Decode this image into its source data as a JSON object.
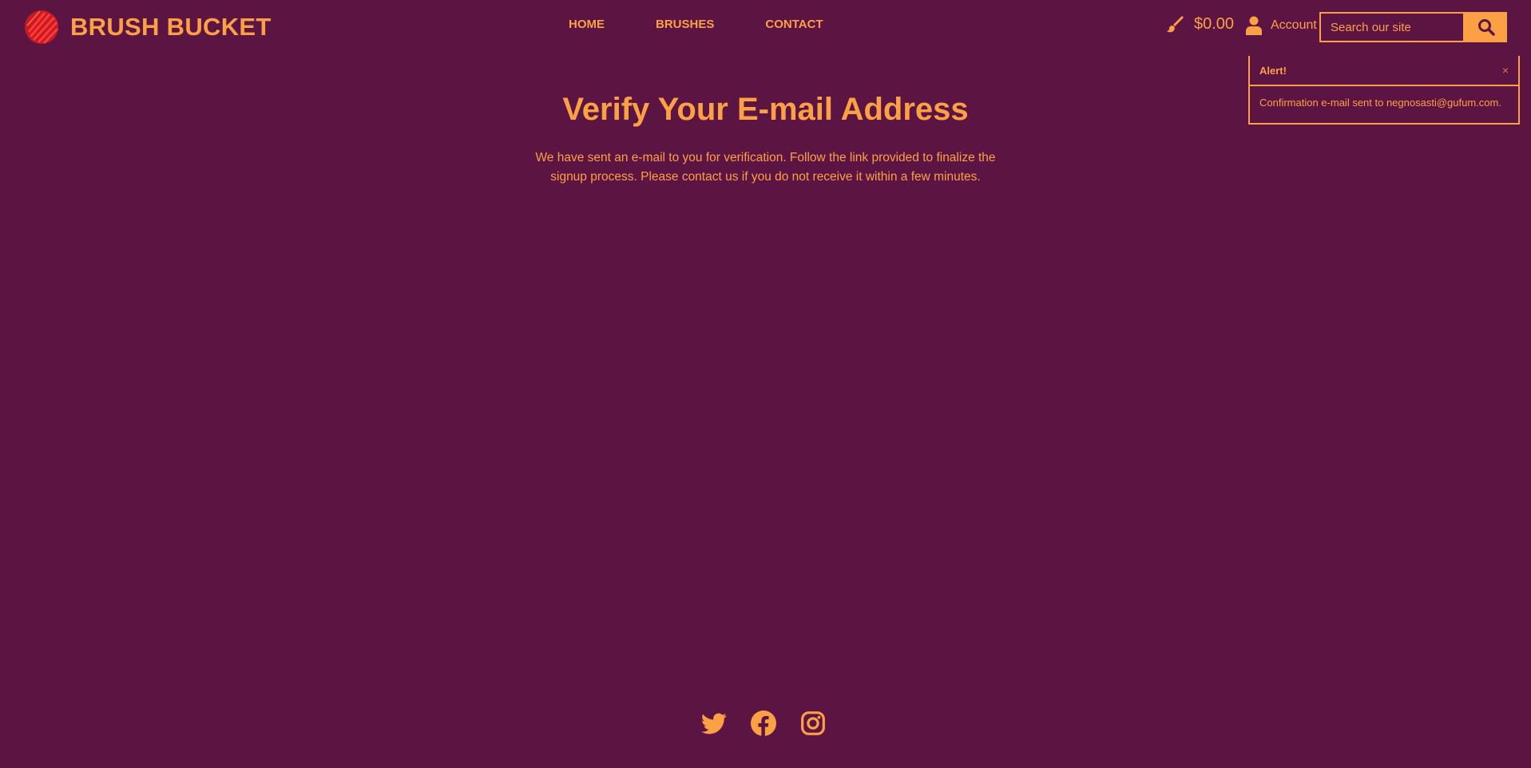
{
  "brand": {
    "name": "BRUSH BUCKET",
    "logo_icon": "brush-bucket-logo"
  },
  "nav": {
    "items": [
      {
        "label": "HOME"
      },
      {
        "label": "BRUSHES"
      },
      {
        "label": "CONTACT"
      }
    ]
  },
  "header": {
    "cart_icon": "paintbrush-icon",
    "cart_total": "$0.00",
    "account_icon": "user-icon",
    "account_label": "Account",
    "search_placeholder": "Search our site",
    "search_icon": "search-icon"
  },
  "alert": {
    "title": "Alert!",
    "close_label": "×",
    "message": "Confirmation e-mail sent to negnosasti@gufum.com."
  },
  "main": {
    "title": "Verify Your E-mail Address",
    "message": "We have sent an e-mail to you for verification. Follow the link provided to finalize the signup process. Please contact us if you do not receive it within a few minutes."
  },
  "footer": {
    "social": [
      {
        "icon": "twitter-icon"
      },
      {
        "icon": "facebook-icon"
      },
      {
        "icon": "instagram-icon"
      }
    ]
  },
  "colors": {
    "background": "#5c1542",
    "accent": "#fca046",
    "logo_red": "#e2252b"
  }
}
